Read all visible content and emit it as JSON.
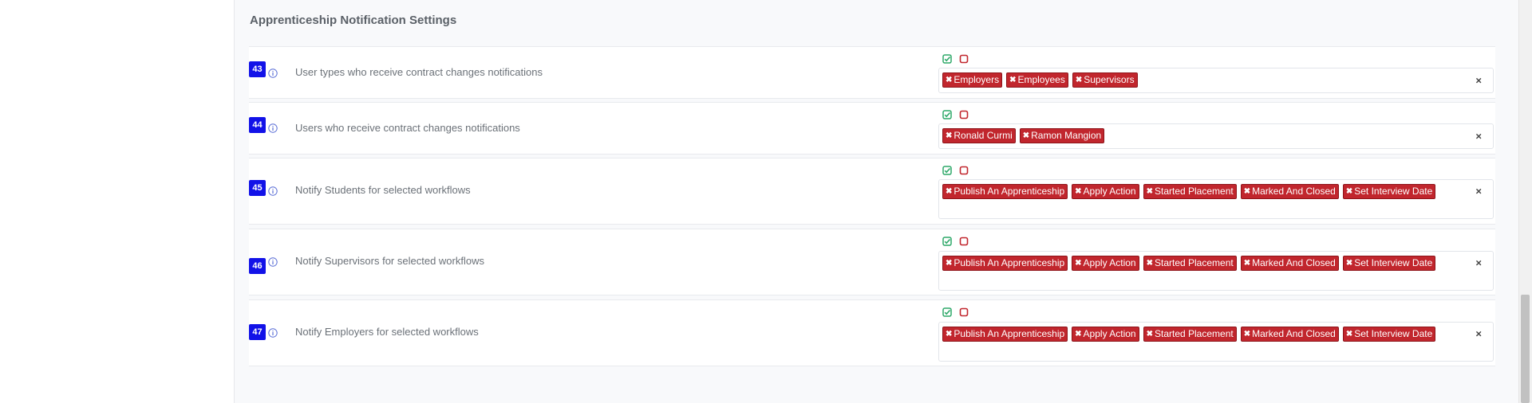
{
  "section": {
    "title": "Apprenticeship Notification Settings"
  },
  "colors": {
    "tag_bg": "#c1262d",
    "badge_bg": "#1212e8",
    "check_green": "#2ea869",
    "square_red": "#c1262d"
  },
  "icons": {
    "info": "info-icon",
    "check": "check-square-icon",
    "square": "square-icon",
    "remove": "x-icon"
  },
  "rows": [
    {
      "number": "43",
      "label": "User types who receive contract changes notifications",
      "tags": [
        "Employers",
        "Employees",
        "Supervisors"
      ]
    },
    {
      "number": "44",
      "label": "Users who receive contract changes notifications",
      "tags": [
        "Ronald Curmi",
        "Ramon Mangion"
      ]
    },
    {
      "number": "45",
      "label": "Notify Students for selected workflows",
      "tags": [
        "Publish An Apprenticeship",
        "Apply Action",
        "Started Placement",
        "Marked And Closed",
        "Set Interview Date"
      ]
    },
    {
      "number": "46",
      "label": "Notify Supervisors for selected workflows",
      "tags": [
        "Publish An Apprenticeship",
        "Apply Action",
        "Started Placement",
        "Marked And Closed",
        "Set Interview Date"
      ]
    },
    {
      "number": "47",
      "label": "Notify Employers for selected workflows",
      "tags": [
        "Publish An Apprenticeship",
        "Apply Action",
        "Started Placement",
        "Marked And Closed",
        "Set Interview Date"
      ]
    }
  ]
}
